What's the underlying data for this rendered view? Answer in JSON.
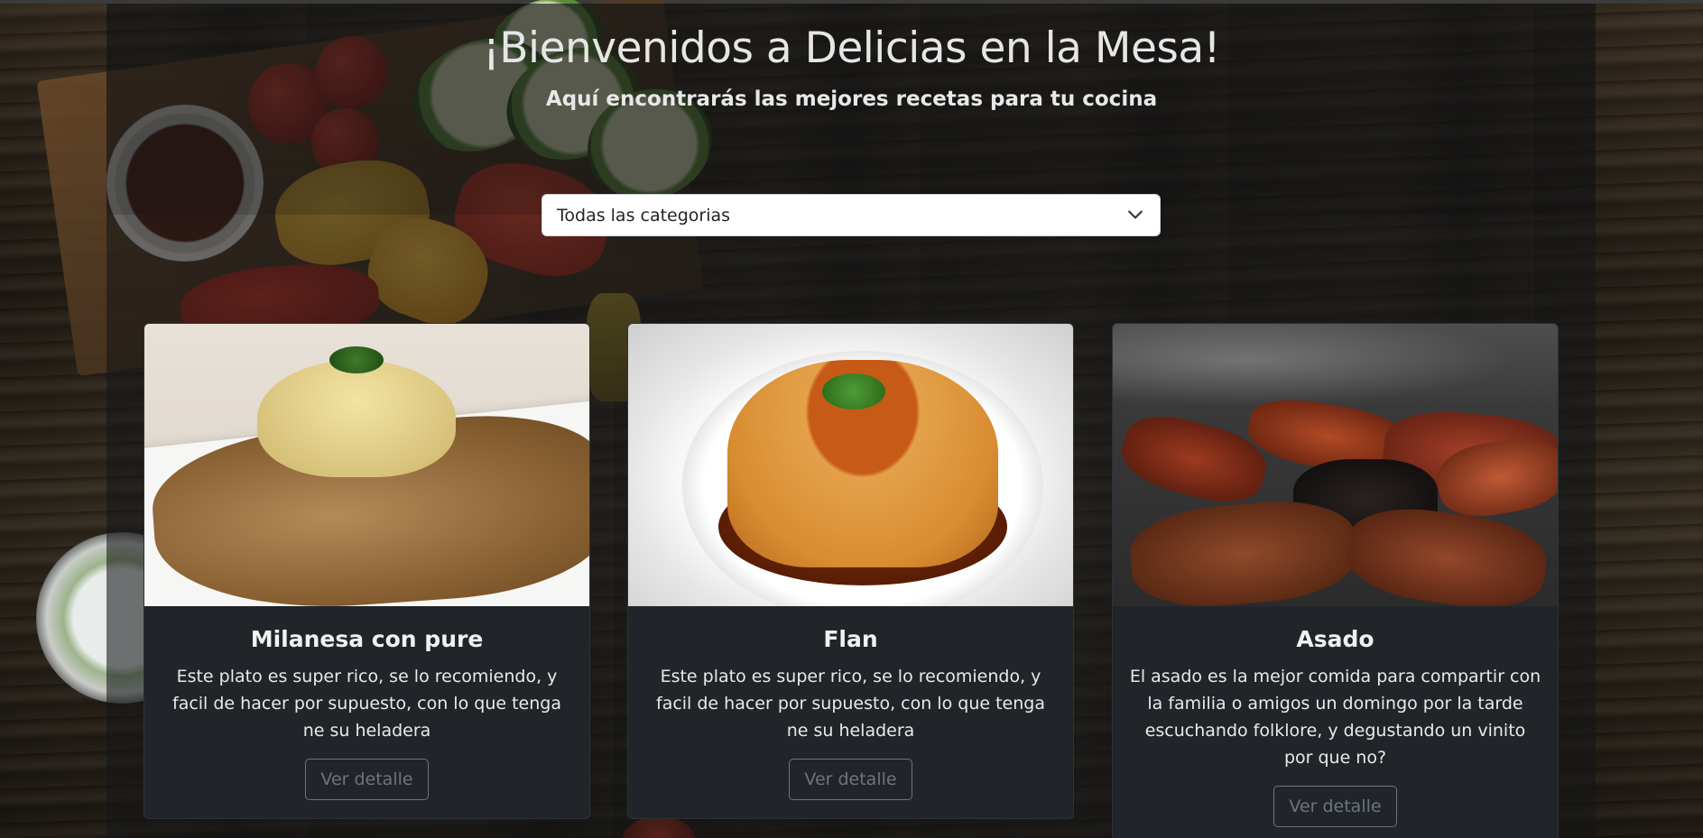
{
  "header": {
    "title": "¡Bienvenidos a Delicias en la Mesa!",
    "subtitle": "Aquí encontrarás las mejores recetas para tu cocina"
  },
  "filter": {
    "selected": "Todas las categorias",
    "icon": "chevron-down-icon"
  },
  "cards": [
    {
      "title": "Milanesa con pure",
      "description": "Este plato es super rico, se lo recomiendo, y facil de hacer por supuesto, con lo que tenga ne su heladera",
      "button": "Ver detalle"
    },
    {
      "title": "Flan",
      "description": "Este plato es super rico, se lo recomiendo, y facil de hacer por supuesto, con lo que tenga ne su heladera",
      "button": "Ver detalle"
    },
    {
      "title": "Asado",
      "description": "El asado es la mejor comida para compartir con la familia o amigos un domingo por la tarde escuchando folklore, y degustando un vinito por que no?",
      "button": "Ver detalle"
    }
  ],
  "colors": {
    "card_bg": "#212529",
    "button_border": "#6c757d",
    "text": "#e9e9e9"
  }
}
